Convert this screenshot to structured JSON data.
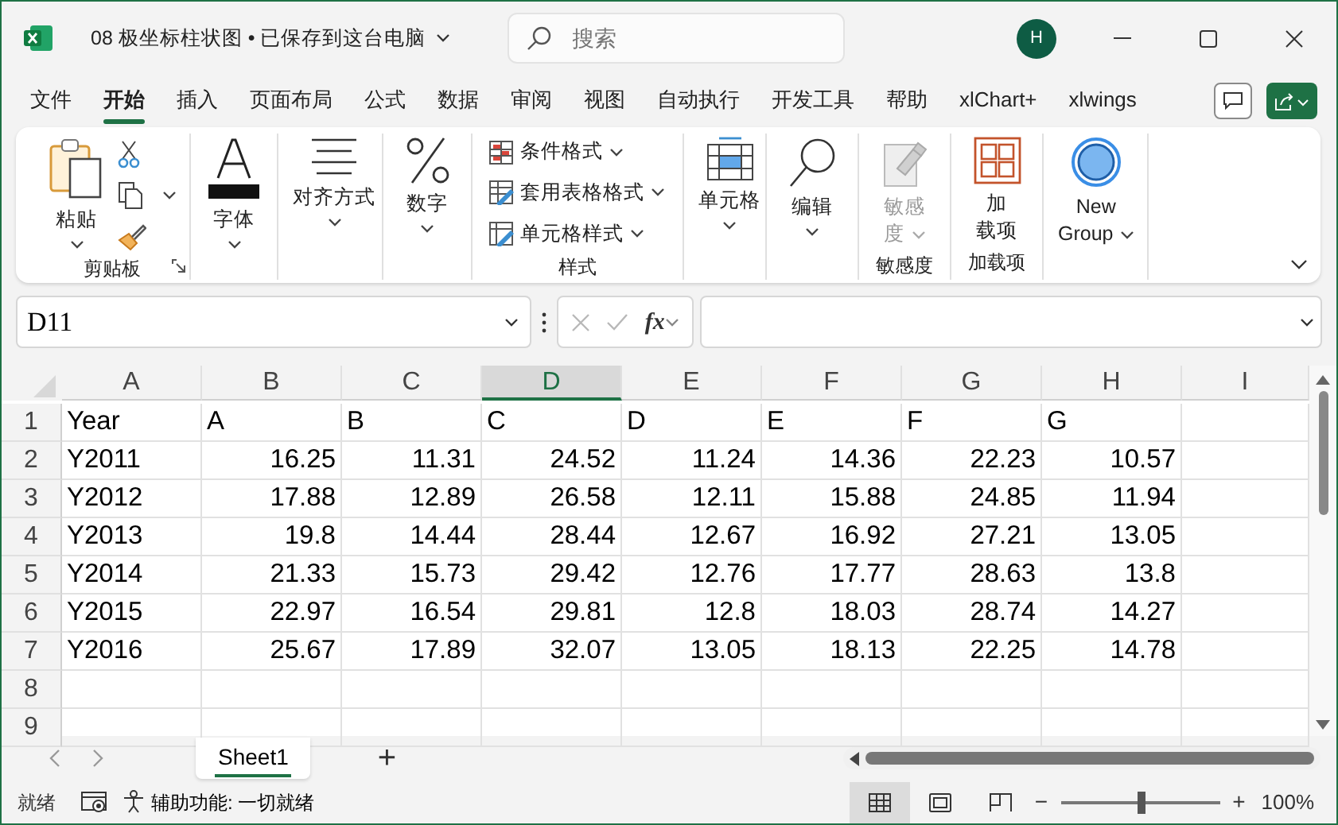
{
  "window": {
    "title": "08 极坐标柱状图 • 已保存到这台电脑",
    "search_placeholder": "搜索",
    "avatar": "H"
  },
  "tabs": [
    {
      "label": "文件",
      "selected": false
    },
    {
      "label": "开始",
      "selected": true
    },
    {
      "label": "插入",
      "selected": false
    },
    {
      "label": "页面布局",
      "selected": false
    },
    {
      "label": "公式",
      "selected": false
    },
    {
      "label": "数据",
      "selected": false
    },
    {
      "label": "审阅",
      "selected": false
    },
    {
      "label": "视图",
      "selected": false
    },
    {
      "label": "自动执行",
      "selected": false
    },
    {
      "label": "开发工具",
      "selected": false
    },
    {
      "label": "帮助",
      "selected": false
    },
    {
      "label": "xlChart+",
      "selected": false
    },
    {
      "label": "xlwings",
      "selected": false
    }
  ],
  "ribbon": {
    "groups": [
      {
        "label": "剪贴板",
        "launcher": true,
        "items": [
          {
            "kind": "paste",
            "lines": [
              "粘贴"
            ],
            "caret": true
          },
          {
            "kind": "clip_tools"
          }
        ]
      },
      {
        "items": [
          {
            "kind": "font",
            "lines": [
              "字体"
            ],
            "caret": true
          }
        ]
      },
      {
        "items": [
          {
            "kind": "align",
            "lines": [
              "对齐方式"
            ],
            "caret": true
          }
        ]
      },
      {
        "items": [
          {
            "kind": "number",
            "lines": [
              "数字"
            ],
            "caret": true
          }
        ]
      },
      {
        "label": "样式",
        "items": [
          {
            "kind": "styles",
            "entries": [
              {
                "label": "条件格式"
              },
              {
                "label": "套用表格格式"
              },
              {
                "label": "单元格样式"
              }
            ]
          }
        ]
      },
      {
        "items": [
          {
            "kind": "cells",
            "lines": [
              "单元格"
            ],
            "caret": true
          }
        ]
      },
      {
        "items": [
          {
            "kind": "editing",
            "lines": [
              "编辑"
            ],
            "caret": true
          }
        ]
      },
      {
        "label": "敏感度",
        "items": [
          {
            "kind": "sensitivity",
            "lines": [
              "敏感",
              "度"
            ],
            "caret": true,
            "disabled": true
          }
        ]
      },
      {
        "label": "加载项",
        "items": [
          {
            "kind": "addins",
            "lines": [
              "加",
              "载项"
            ],
            "caret": false
          }
        ]
      },
      {
        "items": [
          {
            "kind": "newgroup",
            "lines": [
              "New",
              "Group"
            ],
            "caret": true
          }
        ]
      }
    ]
  },
  "formula_bar": {
    "name_box": "D11",
    "function_label": "fx"
  },
  "sheet": {
    "columns": [
      {
        "label": "A",
        "selected": false
      },
      {
        "label": "B",
        "selected": false
      },
      {
        "label": "C",
        "selected": false
      },
      {
        "label": "D",
        "selected": true
      },
      {
        "label": "E",
        "selected": false
      },
      {
        "label": "F",
        "selected": false
      },
      {
        "label": "G",
        "selected": false
      },
      {
        "label": "H",
        "selected": false
      },
      {
        "label": "I",
        "selected": false
      }
    ],
    "rows": [
      {
        "label": "1",
        "cells": [
          "Year",
          "A",
          "B",
          "C",
          "D",
          "E",
          "F",
          "G"
        ]
      },
      {
        "label": "2",
        "cells": [
          "Y2011",
          "16.25",
          "11.31",
          "24.52",
          "11.24",
          "14.36",
          "22.23",
          "10.57"
        ]
      },
      {
        "label": "3",
        "cells": [
          "Y2012",
          "17.88",
          "12.89",
          "26.58",
          "12.11",
          "15.88",
          "24.85",
          "11.94"
        ]
      },
      {
        "label": "4",
        "cells": [
          "Y2013",
          "19.8",
          "14.44",
          "28.44",
          "12.67",
          "16.92",
          "27.21",
          "13.05"
        ]
      },
      {
        "label": "5",
        "cells": [
          "Y2014",
          "21.33",
          "15.73",
          "29.42",
          "12.76",
          "17.77",
          "28.63",
          "13.8"
        ]
      },
      {
        "label": "6",
        "cells": [
          "Y2015",
          "22.97",
          "16.54",
          "29.81",
          "12.8",
          "18.03",
          "28.74",
          "14.27"
        ]
      },
      {
        "label": "7",
        "cells": [
          "Y2016",
          "25.67",
          "17.89",
          "32.07",
          "13.05",
          "18.13",
          "22.25",
          "14.78"
        ]
      },
      {
        "label": "8",
        "cells": []
      },
      {
        "label": "9",
        "cells": []
      }
    ]
  },
  "sheet_tabs": [
    {
      "label": "Sheet1",
      "selected": true
    }
  ],
  "add_sheet": "+",
  "status_bar": {
    "status": "就绪",
    "accessibility": "辅助功能: 一切就绪",
    "views": [
      {
        "kind": "normal",
        "selected": true
      },
      {
        "kind": "page_layout",
        "selected": false
      },
      {
        "kind": "page_break",
        "selected": false
      }
    ],
    "zoom_out": "−",
    "zoom_slider": {
      "level": 0.5
    },
    "zoom_in": "+",
    "zoom": "100%"
  }
}
